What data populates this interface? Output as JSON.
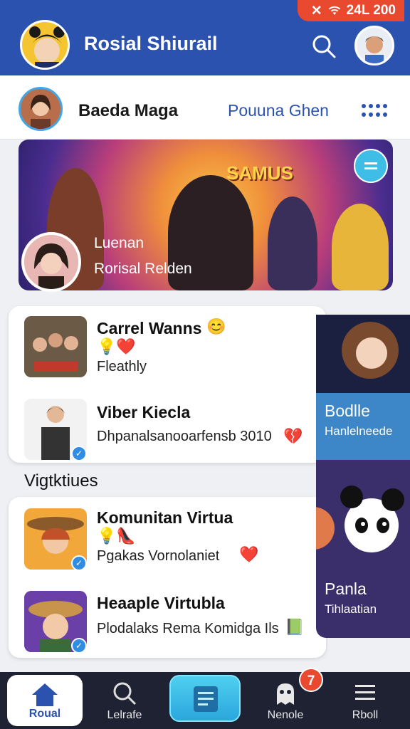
{
  "status_bar": {
    "time": "24L 200"
  },
  "header": {
    "title": "Rosial Shiurail"
  },
  "subheader": {
    "name": "Baeda Maga",
    "link": "Pouuna Ghen"
  },
  "banner": {
    "badge": "SAMUS",
    "title": "Luenan",
    "subtitle": "Rorisal Relden"
  },
  "feed": [
    {
      "title": "Carrel Wanns",
      "subtitle": "Fleathly"
    },
    {
      "title": "Viber Kiecla",
      "subtitle": "Dhpanalsanooarfensb 3010"
    }
  ],
  "section": {
    "title": "Vigtktiues"
  },
  "communities": [
    {
      "title": "Komunitan Virtua",
      "subtitle": "Pgakas Vornolaniet"
    },
    {
      "title": "Heaaple Virtubla",
      "subtitle": "Plodalaks Rema Komidga Ils"
    }
  ],
  "side_cards": [
    {
      "title": "Bodlle",
      "subtitle": "Hanlelneede"
    },
    {
      "title": "Panla",
      "subtitle": "Tihlaatian"
    }
  ],
  "bottom_nav": {
    "items": [
      {
        "label": "Roual",
        "icon": "home-icon"
      },
      {
        "label": "Lelrafe",
        "icon": "search-icon"
      },
      {
        "label": "",
        "icon": "feed-icon"
      },
      {
        "label": "Nenole",
        "icon": "ghost-icon"
      },
      {
        "label": "Rboll",
        "icon": "menu-icon"
      }
    ],
    "badge_count": "7"
  },
  "colors": {
    "brand": "#2c52b0",
    "accent": "#e8492f",
    "cyan": "#3ebde6"
  }
}
